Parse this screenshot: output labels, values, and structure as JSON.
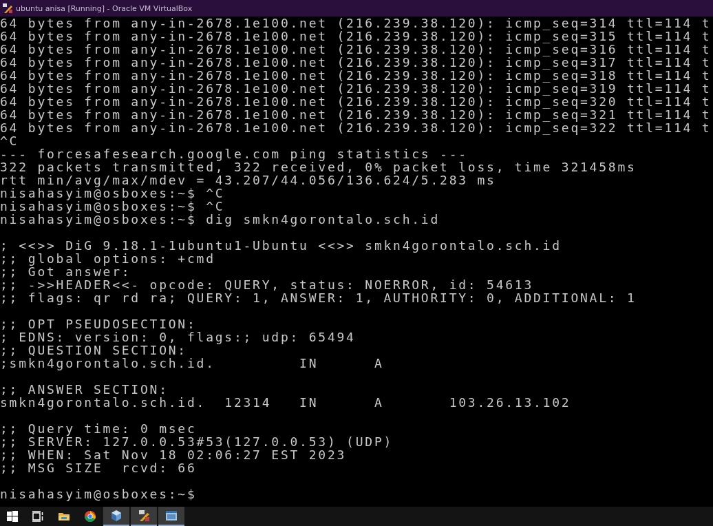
{
  "window": {
    "title": "ubuntu anisa [Running] - Oracle VM VirtualBox"
  },
  "terminal": {
    "blocks": [
      [
        "64 bytes from any-in-2678.1e100.net (216.239.38.120): icmp_seq=314 ttl=114 t",
        "64 bytes from any-in-2678.1e100.net (216.239.38.120): icmp_seq=315 ttl=114 t",
        "64 bytes from any-in-2678.1e100.net (216.239.38.120): icmp_seq=316 ttl=114 t",
        "64 bytes from any-in-2678.1e100.net (216.239.38.120): icmp_seq=317 ttl=114 t",
        "64 bytes from any-in-2678.1e100.net (216.239.38.120): icmp_seq=318 ttl=114 t",
        "64 bytes from any-in-2678.1e100.net (216.239.38.120): icmp_seq=319 ttl=114 t",
        "64 bytes from any-in-2678.1e100.net (216.239.38.120): icmp_seq=320 ttl=114 t",
        "64 bytes from any-in-2678.1e100.net (216.239.38.120): icmp_seq=321 ttl=114 t",
        "64 bytes from any-in-2678.1e100.net (216.239.38.120): icmp_seq=322 ttl=114 t",
        "^C",
        "--- forcesafesearch.google.com ping statistics ---",
        "322 packets transmitted, 322 received, 0% packet loss, time 321458ms",
        "rtt min/avg/max/mdev = 43.207/44.056/136.624/5.283 ms",
        "nisahasyim@osboxes:~$ ^C",
        "nisahasyim@osboxes:~$ ^C",
        "nisahasyim@osboxes:~$ dig smkn4gorontalo.sch.id"
      ],
      [
        "; <<>> DiG 9.18.1-1ubuntu1-Ubuntu <<>> smkn4gorontalo.sch.id",
        ";; global options: +cmd",
        ";; Got answer:",
        ";; ->>HEADER<<- opcode: QUERY, status: NOERROR, id: 54613",
        ";; flags: qr rd ra; QUERY: 1, ANSWER: 1, AUTHORITY: 0, ADDITIONAL: 1"
      ],
      [
        ";; OPT PSEUDOSECTION:",
        "; EDNS: version: 0, flags:; udp: 65494",
        ";; QUESTION SECTION:",
        ";smkn4gorontalo.sch.id.         IN      A"
      ],
      [
        ";; ANSWER SECTION:",
        "smkn4gorontalo.sch.id.  12314   IN      A       103.26.13.102"
      ],
      [
        ";; Query time: 0 msec",
        ";; SERVER: 127.0.0.53#53(127.0.0.53) (UDP)",
        ";; WHEN: Sat Nov 18 02:06:27 EST 2023",
        ";; MSG SIZE  rcvd: 66"
      ],
      [
        "nisahasyim@osboxes:~$"
      ]
    ]
  },
  "taskbar": [
    {
      "kind": "start",
      "open": false
    },
    {
      "kind": "taskview",
      "open": false
    },
    {
      "kind": "folder",
      "open": false
    },
    {
      "kind": "browser",
      "open": false
    },
    {
      "kind": "cube",
      "open": true
    },
    {
      "kind": "vm",
      "open": true
    },
    {
      "kind": "window",
      "open": true
    }
  ]
}
